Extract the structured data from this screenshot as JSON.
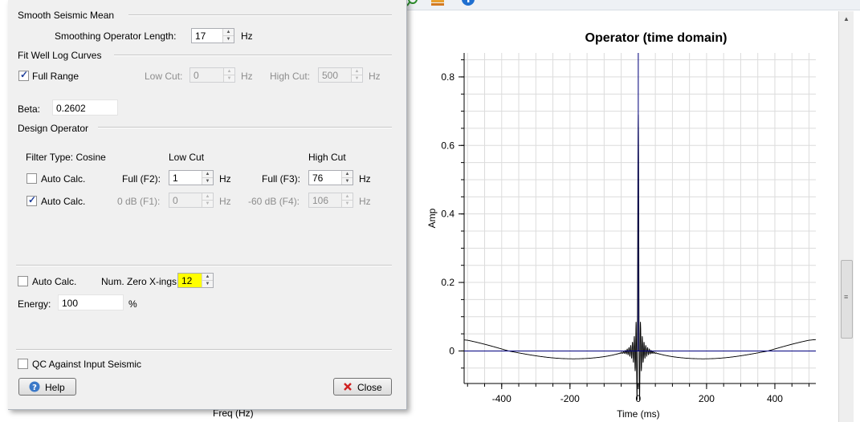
{
  "dialog": {
    "smooth_section": {
      "title": "Smooth Seismic Mean",
      "length_label": "Smoothing Operator Length:",
      "length_value": "17",
      "length_unit": "Hz"
    },
    "fit_section": {
      "title": "Fit Well Log Curves",
      "full_range_label": "Full Range",
      "full_range_checked": true,
      "low_cut_label": "Low Cut:",
      "low_cut_value": "0",
      "low_cut_unit": "Hz",
      "high_cut_label": "High Cut:",
      "high_cut_value": "500",
      "high_cut_unit": "Hz"
    },
    "beta": {
      "label": "Beta:",
      "value": "0.2602"
    },
    "design_section": {
      "title": "Design Operator",
      "filter_type": "Filter Type: Cosine",
      "low_cut_header": "Low Cut",
      "high_cut_header": "High Cut",
      "row1": {
        "auto_label": "Auto Calc.",
        "auto_checked": false,
        "low_label": "Full (F2):",
        "low_value": "1",
        "low_unit": "Hz",
        "high_label": "Full (F3):",
        "high_value": "76",
        "high_unit": "Hz"
      },
      "row2": {
        "auto_label": "Auto Calc.",
        "auto_checked": true,
        "low_label": "0 dB (F1):",
        "low_value": "0",
        "low_unit": "Hz",
        "high_label": "-60 dB (F4):",
        "high_value": "106",
        "high_unit": "Hz"
      }
    },
    "zero_xings": {
      "auto_label": "Auto Calc.",
      "auto_checked": false,
      "label": "Num. Zero X-ings:",
      "value": "12",
      "highlight_color": "#ffff00"
    },
    "energy": {
      "label": "Energy:",
      "value": "100",
      "unit": "%"
    },
    "qc": {
      "label": "QC Against Input Seismic",
      "checked": false
    },
    "help_button": "Help",
    "close_button": "Close"
  },
  "background": {
    "freq_label": "Freq (Hz)",
    "toolbar_icons": [
      "zoom-icon",
      "layers-icon",
      "info-icon"
    ]
  },
  "chart_data": {
    "type": "line",
    "title": "Operator (time domain)",
    "xlabel": "Time (ms)",
    "ylabel": "Amp",
    "xlim": [
      -510,
      520
    ],
    "ylim": [
      -0.095,
      0.87
    ],
    "xticks": [
      -400,
      -200,
      0,
      200,
      400
    ],
    "yticks": [
      0,
      0.2,
      0.4,
      0.6,
      0.8
    ],
    "grid": true,
    "series": [
      {
        "color": "#000000",
        "style": "sinc-windowed",
        "peak": {
          "x": 0,
          "y": 0.69
        },
        "ringing_extent_ms": 60,
        "trough_x": [
          -190,
          190
        ],
        "trough_y": -0.023,
        "edge_y": 0.013
      },
      {
        "color": "#00007f",
        "style": "zero-line-with-spike",
        "spike_x": 0,
        "spike_top": 0.87
      }
    ],
    "colors": {
      "grid": "#dcdcdc",
      "axis": "#000000"
    }
  }
}
